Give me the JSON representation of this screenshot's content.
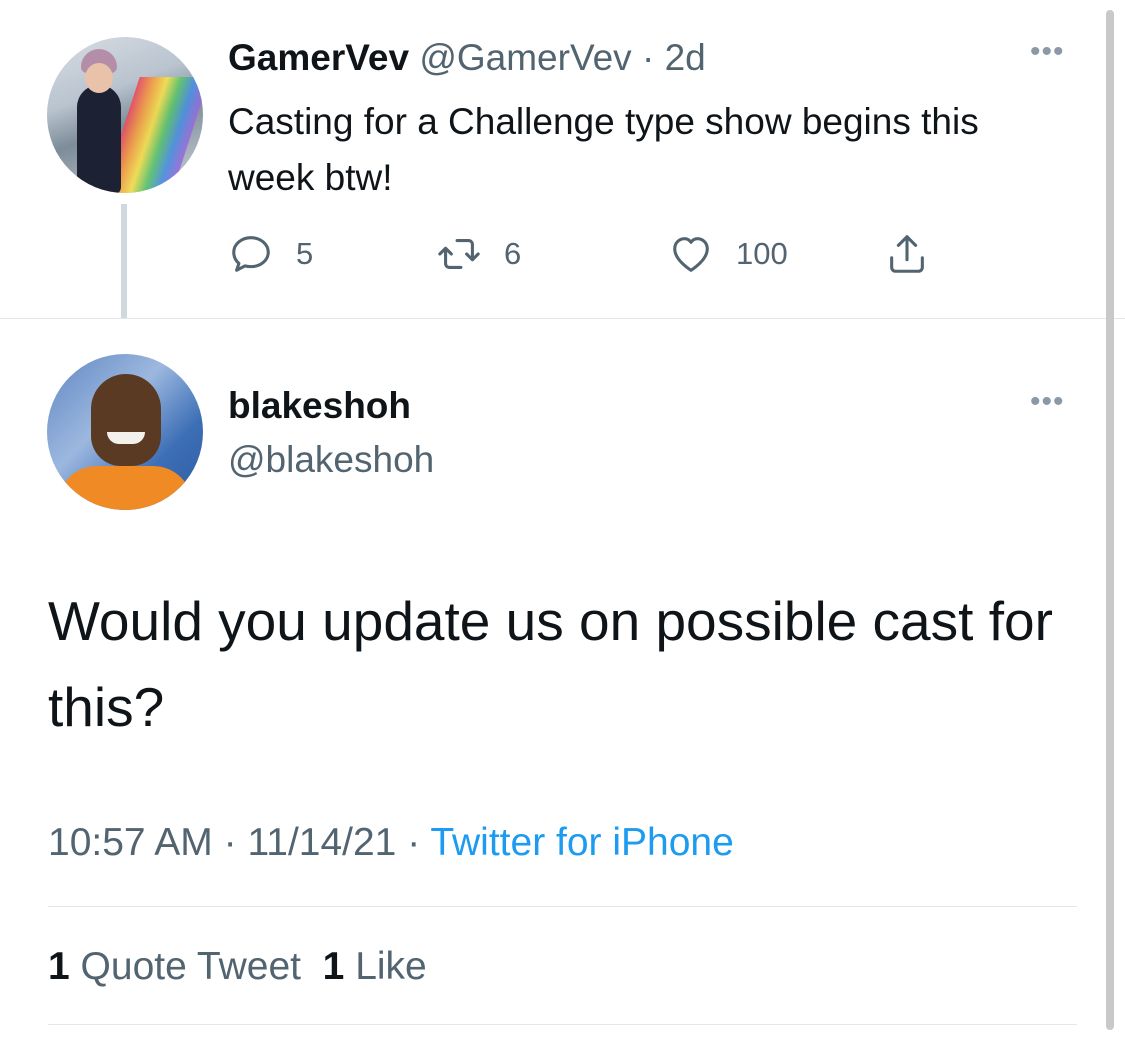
{
  "parent_tweet": {
    "display_name": "GamerVev",
    "handle": "@GamerVev",
    "separator": " · ",
    "age": "2d",
    "text": "Casting for a Challenge type show begins this week btw!",
    "more_icon": "more-dots-icon",
    "actions": {
      "reply_count": "5",
      "retweet_count": "6",
      "like_count": "100"
    }
  },
  "main_tweet": {
    "display_name": "blakeshoh",
    "handle": "@blakeshoh",
    "text": "Would you update us on possible cast for this?",
    "time": "10:57 AM",
    "date": "11/14/21",
    "dot": " · ",
    "source": "Twitter for iPhone",
    "stats": {
      "quote_count": "1",
      "quote_label": "Quote Tweet",
      "like_count": "1",
      "like_label": "Like"
    }
  },
  "colors": {
    "link": "#1d9bf0",
    "muted": "#536471",
    "text": "#0f1419"
  },
  "icons": [
    "reply-icon",
    "retweet-icon",
    "like-icon",
    "share-icon",
    "more-dots-icon"
  ]
}
